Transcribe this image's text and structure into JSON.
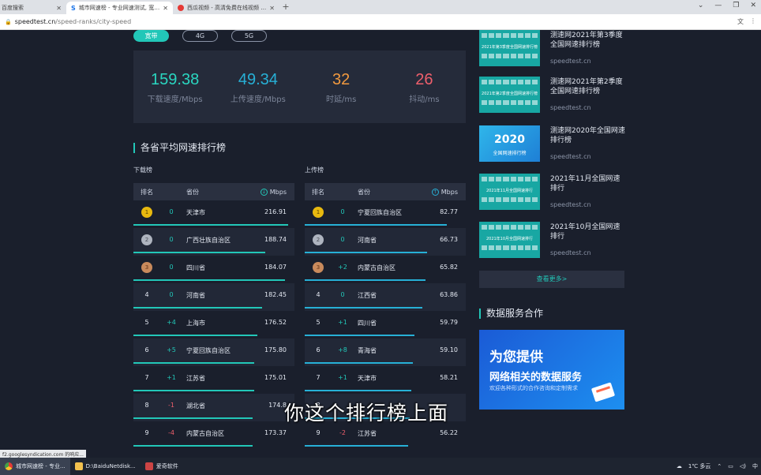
{
  "browser": {
    "tabs": [
      {
        "title": "百度搜索",
        "active": false
      },
      {
        "title": "城市网速榜 - 专业网速测试, 宽带...",
        "active": true
      },
      {
        "title": "西瓜视频 - 高清免费在线视频 - ...",
        "active": false
      }
    ],
    "new_tab": "+",
    "window_controls": [
      "⌄",
      "—",
      "❐",
      "✕"
    ],
    "url_host": "speedtest.cn",
    "url_path": "/speed-ranks/city-speed"
  },
  "net_tabs": [
    "宽带",
    "4G",
    "5G"
  ],
  "stats": [
    {
      "value": "159.38",
      "label": "下载速度/Mbps",
      "color": "#2ad6c0"
    },
    {
      "value": "49.34",
      "label": "上传速度/Mbps",
      "color": "#27b0d6"
    },
    {
      "value": "32",
      "label": "时延/ms",
      "color": "#f29a3f"
    },
    {
      "value": "26",
      "label": "抖动/ms",
      "color": "#ef5f6c"
    }
  ],
  "section_title": "各省平均网速排行榜",
  "download_label": "下载榜",
  "upload_label": "上传榜",
  "table_headers": {
    "rank": "排名",
    "province": "省份",
    "unit": "Mbps"
  },
  "download_rows": [
    {
      "rank": "1",
      "change": "0",
      "province": "天津市",
      "speed": "216.91",
      "bar": 0.96
    },
    {
      "rank": "2",
      "change": "0",
      "province": "广西壮族自治区",
      "speed": "188.74",
      "bar": 0.82
    },
    {
      "rank": "3",
      "change": "0",
      "province": "四川省",
      "speed": "184.07",
      "bar": 0.94
    },
    {
      "rank": "4",
      "change": "0",
      "province": "河南省",
      "speed": "182.45",
      "bar": 0.8
    },
    {
      "rank": "5",
      "change": "+4",
      "province": "上海市",
      "speed": "176.52",
      "bar": 0.77
    },
    {
      "rank": "6",
      "change": "+5",
      "province": "宁夏回族自治区",
      "speed": "175.80",
      "bar": 0.75
    },
    {
      "rank": "7",
      "change": "+1",
      "province": "江苏省",
      "speed": "175.01",
      "bar": 0.75
    },
    {
      "rank": "8",
      "change": "-1",
      "province": "湖北省",
      "speed": "174.8",
      "bar": 0.74
    },
    {
      "rank": "9",
      "change": "-4",
      "province": "内蒙古自治区",
      "speed": "173.37",
      "bar": 0.74
    }
  ],
  "upload_rows": [
    {
      "rank": "1",
      "change": "0",
      "province": "宁夏回族自治区",
      "speed": "82.77",
      "bar": 0.88
    },
    {
      "rank": "2",
      "change": "0",
      "province": "河南省",
      "speed": "66.73",
      "bar": 0.76
    },
    {
      "rank": "3",
      "change": "+2",
      "province": "内蒙古自治区",
      "speed": "65.82",
      "bar": 0.75
    },
    {
      "rank": "4",
      "change": "0",
      "province": "江西省",
      "speed": "63.86",
      "bar": 0.73
    },
    {
      "rank": "5",
      "change": "+1",
      "province": "四川省",
      "speed": "59.79",
      "bar": 0.68
    },
    {
      "rank": "6",
      "change": "+8",
      "province": "青海省",
      "speed": "59.10",
      "bar": 0.67
    },
    {
      "rank": "7",
      "change": "+1",
      "province": "天津市",
      "speed": "58.21",
      "bar": 0.66
    },
    {
      "rank": "8",
      "change": "",
      "province": "",
      "speed": "",
      "bar": 0.65
    },
    {
      "rank": "9",
      "change": "-2",
      "province": "江苏省",
      "speed": "56.22",
      "bar": 0.64
    }
  ],
  "news": [
    {
      "title": "测速网2021年第3季度全国网速排行榜",
      "source": "speedtest.cn",
      "thumb_caption": "2021年第3季度全国网速排行榜"
    },
    {
      "title": "测速网2021年第2季度全国网速排行榜",
      "source": "speedtest.cn",
      "thumb_caption": "2021年第2季度全国网速排行榜"
    },
    {
      "title": "测速网2020年全国网速排行榜",
      "source": "speedtest.cn",
      "thumb_big": "2020",
      "thumb_caption": "全国网速排行榜"
    },
    {
      "title": "2021年11月全国网速排行",
      "source": "speedtest.cn",
      "thumb_caption": "2021年11月全国网速排行"
    },
    {
      "title": "2021年10月全国网速排行",
      "source": "speedtest.cn",
      "thumb_caption": "2021年10月全国网速排行"
    }
  ],
  "more_button": "查看更多>",
  "data_service_title": "数据服务合作",
  "banner": {
    "line1": "为您提供",
    "line2": "网络相关的数据服务",
    "line3": "欢迎各种形式的合作咨询和定制需求"
  },
  "video_subtitle": "你这个排行榜上面",
  "status_tip": "f2.googlesyndication.com 的响应...",
  "taskbar": {
    "items": [
      "城市网速榜 - 专业...",
      "D:\\BaiduNetdisk...",
      "爱奇软件"
    ],
    "weather": "1℃ 多云",
    "ime": "中"
  }
}
